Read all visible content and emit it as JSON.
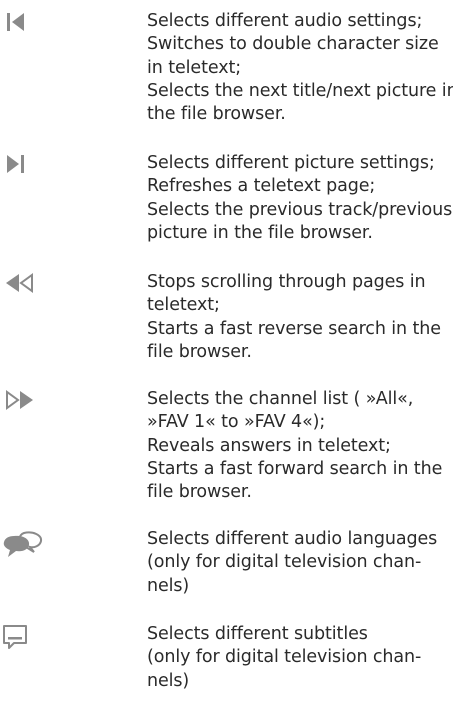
{
  "entries": [
    {
      "icon": "skip-back-icon",
      "lines": [
        "Selects different audio settings;",
        "Switches to double character size",
        "in teletext;",
        "Selects the next title/next picture in",
        "the file browser."
      ]
    },
    {
      "icon": "skip-forward-icon",
      "lines": [
        "Selects different picture settings;",
        "Refreshes a teletext page;",
        "Selects the previous track/previous",
        "picture in the file browser."
      ]
    },
    {
      "icon": "rewind-icon",
      "lines": [
        "Stops scrolling through pages in",
        "teletext;",
        "Starts a fast reverse search in the",
        "file browser."
      ]
    },
    {
      "icon": "fast-forward-icon",
      "lines": [
        "Selects the channel list ( »All«,",
        "»FAV 1« to »FAV 4«);",
        "Reveals answers in teletext;",
        "Starts a fast forward search in the",
        "file browser."
      ]
    },
    {
      "icon": "speech-bubbles-icon",
      "lines": [
        "Selects different audio languages",
        "(only for digital television chan-",
        "nels)"
      ]
    },
    {
      "icon": "subtitles-icon",
      "lines": [
        "Selects different subtitles",
        "(only for digital television chan-",
        "nels)"
      ]
    }
  ]
}
